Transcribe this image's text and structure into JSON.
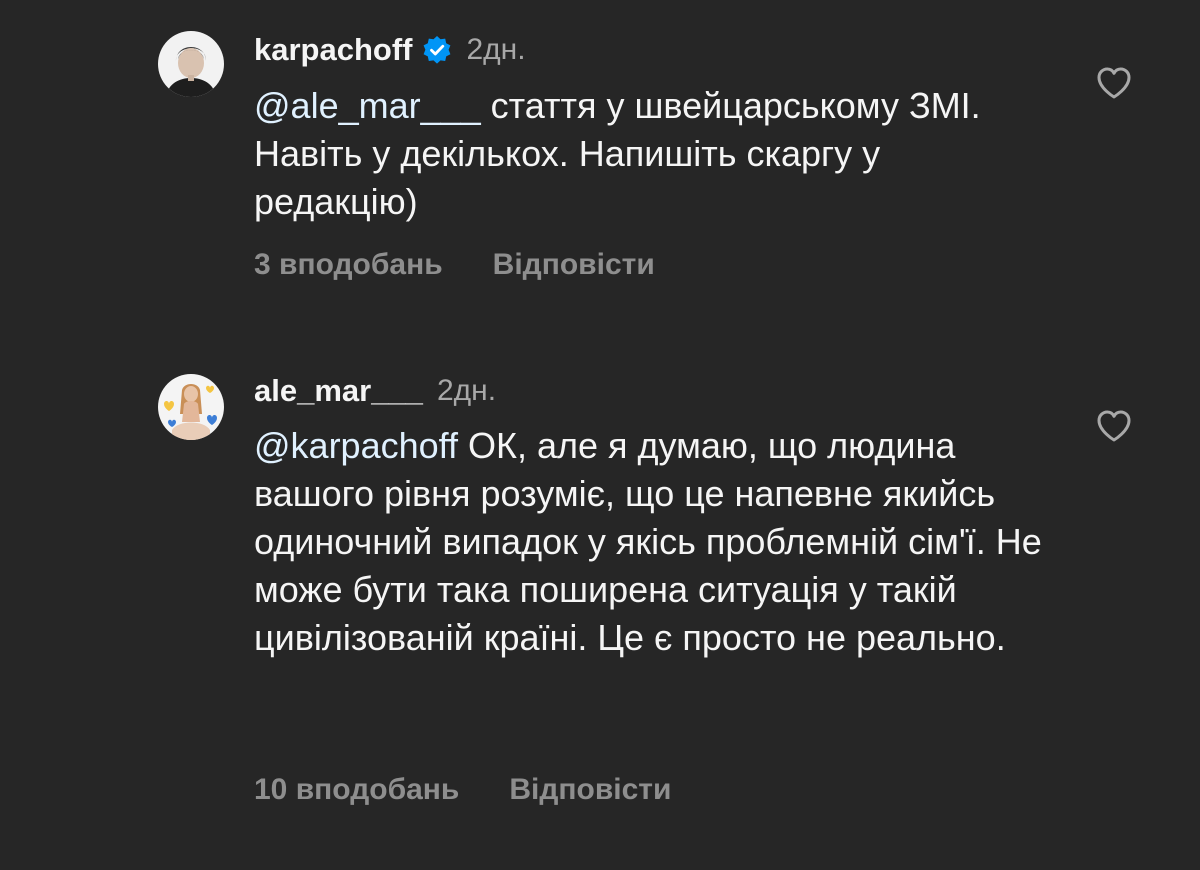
{
  "comments": [
    {
      "username": "karpachoff",
      "verified": true,
      "time": "2дн.",
      "mention": "@ale_mar___",
      "text": " стаття у швейцарському ЗМІ. Навіть у декількох. Напишіть скаргу у редакцію)",
      "likes": "3 вподобань",
      "reply": "Відповісти"
    },
    {
      "username": "ale_mar___",
      "verified": false,
      "time": "2дн.",
      "mention": "@karpachoff",
      "text": " ОК, але я думаю, що людина вашого рівня розуміє, що це напевне якийсь одиночний випадок у якісь проблемній сім'ї. Не може бути така поширена ситуація у такій цивілізованій країні. Це є просто не реально.",
      "likes": "10 вподобань",
      "reply": "Відповісти"
    }
  ],
  "colors": {
    "background": "#262626",
    "text": "#f5f5f5",
    "mention": "#e0f1ff",
    "secondary": "#a8a8a8",
    "meta": "#8e8e8e",
    "verified": "#0095f6"
  },
  "icons": {
    "verified": "verified-badge-icon",
    "like": "heart-outline-icon"
  }
}
